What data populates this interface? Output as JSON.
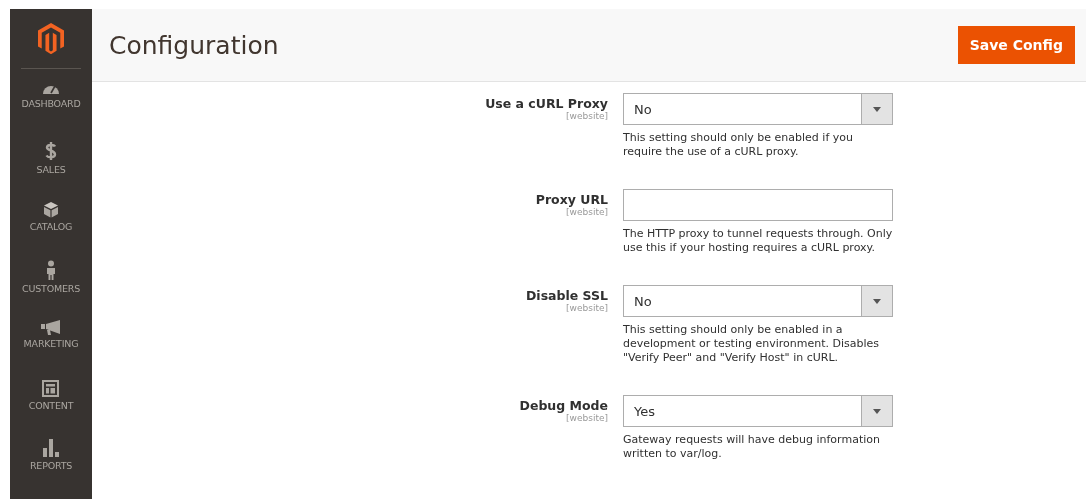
{
  "sidebar": {
    "items": [
      {
        "label": "DASHBOARD",
        "kind": "gauge"
      },
      {
        "label": "SALES",
        "kind": "dollar"
      },
      {
        "label": "CATALOG",
        "kind": "box"
      },
      {
        "label": "CUSTOMERS",
        "kind": "person"
      },
      {
        "label": "MARKETING",
        "kind": "megaphone"
      },
      {
        "label": "CONTENT",
        "kind": "layout"
      },
      {
        "label": "REPORTS",
        "kind": "bars"
      }
    ]
  },
  "header": {
    "title": "Configuration",
    "save_button": "Save Config"
  },
  "fields": [
    {
      "label": "Use a cURL Proxy",
      "scope": "[website]",
      "kind": "select",
      "value": "No",
      "comment": "This setting should only be enabled if you require the use of a cURL proxy."
    },
    {
      "label": "Proxy URL",
      "scope": "[website]",
      "kind": "text",
      "comment": "The HTTP proxy to tunnel requests through. Only use this if your hosting requires a cURL proxy."
    },
    {
      "label": "Disable SSL",
      "scope": "[website]",
      "kind": "select",
      "value": "No",
      "comment": "This setting should only be enabled in a development or testing environment. Disables \"Verify Peer\" and \"Verify Host\" in cURL."
    },
    {
      "label": "Debug Mode",
      "scope": "[website]",
      "kind": "select",
      "value": "Yes",
      "comment": "Gateway requests will have debug information written to var/log."
    }
  ]
}
